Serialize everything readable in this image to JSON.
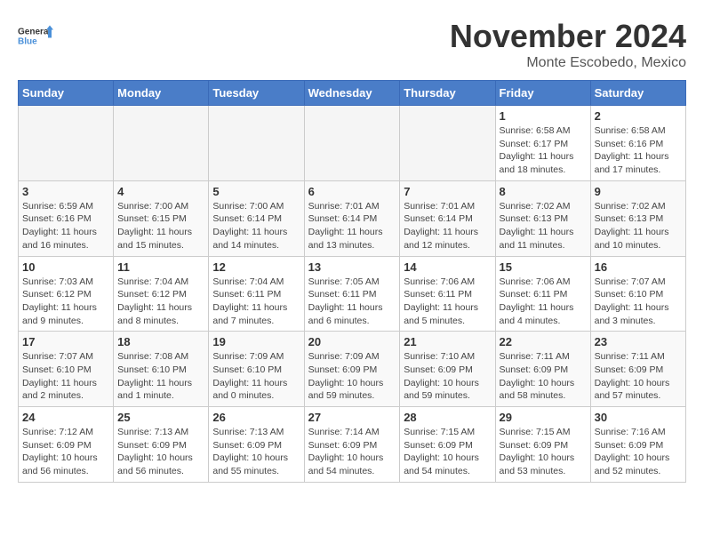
{
  "logo": {
    "text_general": "General",
    "text_blue": "Blue"
  },
  "header": {
    "month": "November 2024",
    "location": "Monte Escobedo, Mexico"
  },
  "weekdays": [
    "Sunday",
    "Monday",
    "Tuesday",
    "Wednesday",
    "Thursday",
    "Friday",
    "Saturday"
  ],
  "weeks": [
    [
      {
        "day": "",
        "info": ""
      },
      {
        "day": "",
        "info": ""
      },
      {
        "day": "",
        "info": ""
      },
      {
        "day": "",
        "info": ""
      },
      {
        "day": "",
        "info": ""
      },
      {
        "day": "1",
        "info": "Sunrise: 6:58 AM\nSunset: 6:17 PM\nDaylight: 11 hours and 18 minutes."
      },
      {
        "day": "2",
        "info": "Sunrise: 6:58 AM\nSunset: 6:16 PM\nDaylight: 11 hours and 17 minutes."
      }
    ],
    [
      {
        "day": "3",
        "info": "Sunrise: 6:59 AM\nSunset: 6:16 PM\nDaylight: 11 hours and 16 minutes."
      },
      {
        "day": "4",
        "info": "Sunrise: 7:00 AM\nSunset: 6:15 PM\nDaylight: 11 hours and 15 minutes."
      },
      {
        "day": "5",
        "info": "Sunrise: 7:00 AM\nSunset: 6:14 PM\nDaylight: 11 hours and 14 minutes."
      },
      {
        "day": "6",
        "info": "Sunrise: 7:01 AM\nSunset: 6:14 PM\nDaylight: 11 hours and 13 minutes."
      },
      {
        "day": "7",
        "info": "Sunrise: 7:01 AM\nSunset: 6:14 PM\nDaylight: 11 hours and 12 minutes."
      },
      {
        "day": "8",
        "info": "Sunrise: 7:02 AM\nSunset: 6:13 PM\nDaylight: 11 hours and 11 minutes."
      },
      {
        "day": "9",
        "info": "Sunrise: 7:02 AM\nSunset: 6:13 PM\nDaylight: 11 hours and 10 minutes."
      }
    ],
    [
      {
        "day": "10",
        "info": "Sunrise: 7:03 AM\nSunset: 6:12 PM\nDaylight: 11 hours and 9 minutes."
      },
      {
        "day": "11",
        "info": "Sunrise: 7:04 AM\nSunset: 6:12 PM\nDaylight: 11 hours and 8 minutes."
      },
      {
        "day": "12",
        "info": "Sunrise: 7:04 AM\nSunset: 6:11 PM\nDaylight: 11 hours and 7 minutes."
      },
      {
        "day": "13",
        "info": "Sunrise: 7:05 AM\nSunset: 6:11 PM\nDaylight: 11 hours and 6 minutes."
      },
      {
        "day": "14",
        "info": "Sunrise: 7:06 AM\nSunset: 6:11 PM\nDaylight: 11 hours and 5 minutes."
      },
      {
        "day": "15",
        "info": "Sunrise: 7:06 AM\nSunset: 6:11 PM\nDaylight: 11 hours and 4 minutes."
      },
      {
        "day": "16",
        "info": "Sunrise: 7:07 AM\nSunset: 6:10 PM\nDaylight: 11 hours and 3 minutes."
      }
    ],
    [
      {
        "day": "17",
        "info": "Sunrise: 7:07 AM\nSunset: 6:10 PM\nDaylight: 11 hours and 2 minutes."
      },
      {
        "day": "18",
        "info": "Sunrise: 7:08 AM\nSunset: 6:10 PM\nDaylight: 11 hours and 1 minute."
      },
      {
        "day": "19",
        "info": "Sunrise: 7:09 AM\nSunset: 6:10 PM\nDaylight: 11 hours and 0 minutes."
      },
      {
        "day": "20",
        "info": "Sunrise: 7:09 AM\nSunset: 6:09 PM\nDaylight: 10 hours and 59 minutes."
      },
      {
        "day": "21",
        "info": "Sunrise: 7:10 AM\nSunset: 6:09 PM\nDaylight: 10 hours and 59 minutes."
      },
      {
        "day": "22",
        "info": "Sunrise: 7:11 AM\nSunset: 6:09 PM\nDaylight: 10 hours and 58 minutes."
      },
      {
        "day": "23",
        "info": "Sunrise: 7:11 AM\nSunset: 6:09 PM\nDaylight: 10 hours and 57 minutes."
      }
    ],
    [
      {
        "day": "24",
        "info": "Sunrise: 7:12 AM\nSunset: 6:09 PM\nDaylight: 10 hours and 56 minutes."
      },
      {
        "day": "25",
        "info": "Sunrise: 7:13 AM\nSunset: 6:09 PM\nDaylight: 10 hours and 56 minutes."
      },
      {
        "day": "26",
        "info": "Sunrise: 7:13 AM\nSunset: 6:09 PM\nDaylight: 10 hours and 55 minutes."
      },
      {
        "day": "27",
        "info": "Sunrise: 7:14 AM\nSunset: 6:09 PM\nDaylight: 10 hours and 54 minutes."
      },
      {
        "day": "28",
        "info": "Sunrise: 7:15 AM\nSunset: 6:09 PM\nDaylight: 10 hours and 54 minutes."
      },
      {
        "day": "29",
        "info": "Sunrise: 7:15 AM\nSunset: 6:09 PM\nDaylight: 10 hours and 53 minutes."
      },
      {
        "day": "30",
        "info": "Sunrise: 7:16 AM\nSunset: 6:09 PM\nDaylight: 10 hours and 52 minutes."
      }
    ]
  ]
}
